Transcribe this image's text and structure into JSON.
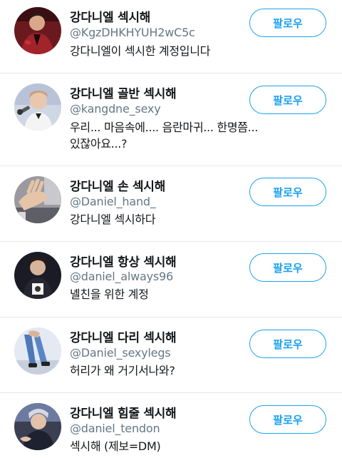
{
  "follow_label": "팔로우",
  "accent_color": "#1da1f2",
  "accounts": [
    {
      "name": "강다니엘 섹시해",
      "handle": "@KgzDHKHYUH2wC5c",
      "bio_lines": [
        "강다니엘이 섹시한 계정입니다"
      ],
      "avatar_icon": "person-red-suit-avatar"
    },
    {
      "name": "강다니엘 골반 섹시해",
      "handle": "@kangdne_sexy",
      "bio_lines": [
        "우리... 마음속에.... 음란마귀... 한명쯤...",
        "있잖아요...?"
      ],
      "avatar_icon": "person-microphone-avatar"
    },
    {
      "name": "강다니엘 손 섹시해",
      "handle": "@Daniel_hand_",
      "bio_lines": [
        "강다니엘 섹시하다"
      ],
      "avatar_icon": "hand-avatar"
    },
    {
      "name": "강다니엘 항상 섹시해",
      "handle": "@daniel_always96",
      "bio_lines": [
        "녤친을 위한 계정"
      ],
      "avatar_icon": "person-dark-stage-avatar"
    },
    {
      "name": "강다니엘 다리 섹시해",
      "handle": "@Daniel_sexylegs",
      "bio_lines": [
        "허리가 왜 거기서나와?"
      ],
      "avatar_icon": "legs-avatar"
    },
    {
      "name": "강다니엘 힘줄 섹시해",
      "handle": "@daniel_tendon",
      "bio_lines": [
        "섹시해 (제보=DM)"
      ],
      "avatar_icon": "person-silver-hair-avatar"
    }
  ]
}
